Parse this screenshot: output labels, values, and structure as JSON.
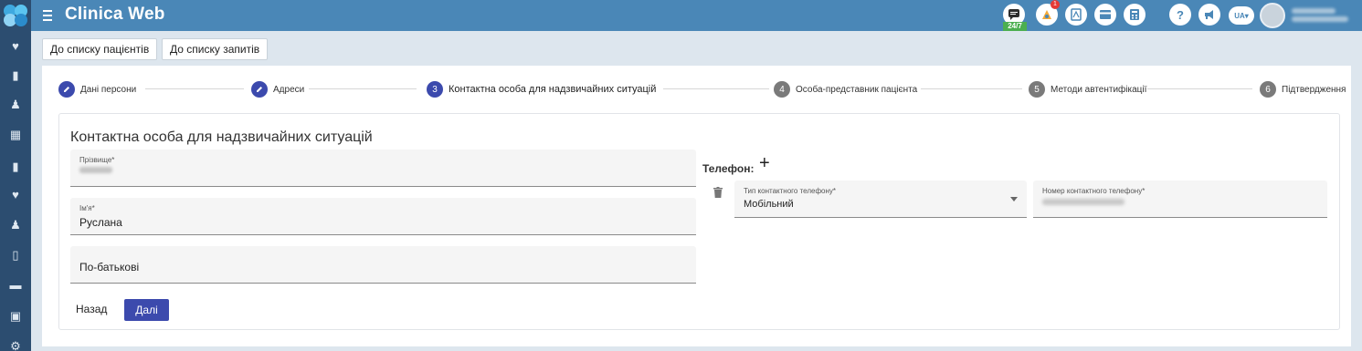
{
  "app": {
    "title": "Clinica Web"
  },
  "topbar": {
    "chat_badge": "24/7",
    "notification_count": "1",
    "help_label": "?",
    "language": "UA"
  },
  "nav": {
    "back_to_patients": "До списку пацієнтів",
    "back_to_requests": "До списку запитів"
  },
  "stepper": {
    "steps": [
      {
        "label": "Дані персони",
        "state": "done",
        "marker": ""
      },
      {
        "label": "Адреси",
        "state": "done",
        "marker": ""
      },
      {
        "label": "Контактна особа для надзвичайних ситуацій",
        "state": "active",
        "marker": "3"
      },
      {
        "label": "Особа-представник пацієнта",
        "state": "todo",
        "marker": "4"
      },
      {
        "label": "Методи автентифікації",
        "state": "todo",
        "marker": "5"
      },
      {
        "label": "Підтвердження",
        "state": "todo",
        "marker": "6"
      }
    ]
  },
  "form": {
    "title": "Контактна особа для надзвичайних ситуацій",
    "surname": {
      "label": "Прізвище*",
      "value": ""
    },
    "first_name": {
      "label": "Ім'я*",
      "value": "Руслана"
    },
    "patronymic": {
      "placeholder": "По-батькові",
      "value": ""
    },
    "phone_section": {
      "title": "Телефон:",
      "add_label": "+",
      "type_label": "Тип контактного телефону*",
      "type_value": "Мобільний",
      "number_label": "Номер контактного телефону*",
      "number_value": ""
    },
    "back_button": "Назад",
    "next_button": "Далі"
  },
  "colors": {
    "topbar": "#4a87b7",
    "sidebar": "#2c4d70",
    "accent": "#3c4aad",
    "badge_green": "#4caf50"
  }
}
